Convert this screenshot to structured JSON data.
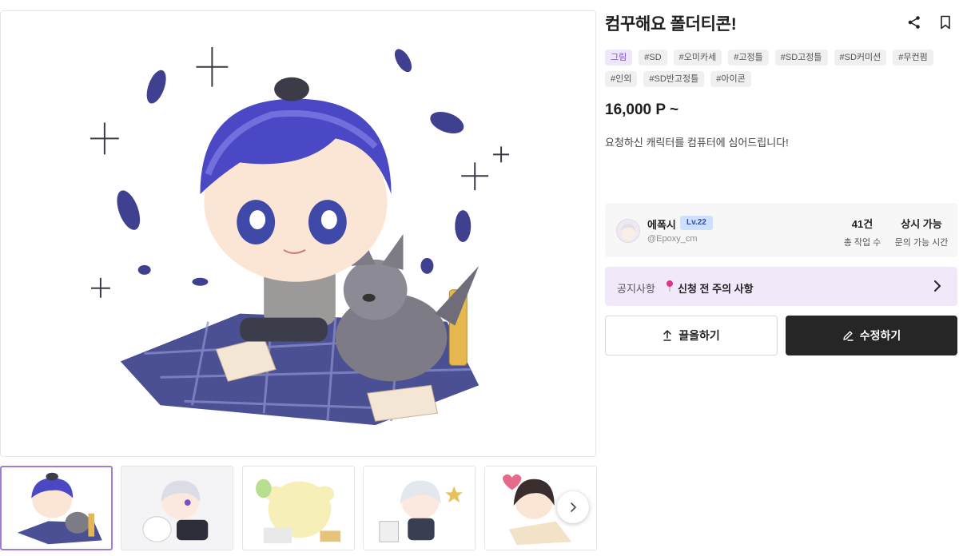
{
  "product": {
    "title": "컴꾸해요 폴더티콘!",
    "price": "16,000 P ~",
    "description": "요청하신 캐릭터를 컴퓨터에 심어드립니다!",
    "tags_row1": [
      "그림",
      "#SD",
      "#오미카세",
      "#고정틀",
      "#SD고정틀",
      "#SD커미션",
      "#무컨펌"
    ],
    "tags_row2": [
      "#인외",
      "#SD반고정틀",
      "#아이콘"
    ]
  },
  "seller": {
    "name": "에폭시",
    "level": "Lv.22",
    "handle": "@Epoxy_cm",
    "stat1_value": "41건",
    "stat1_label": "총 작업 수",
    "stat2_value": "상시 가능",
    "stat2_label": "문의 가능 시간"
  },
  "notice": {
    "label": "공지사항",
    "text": "신청 전 주의 사항"
  },
  "buttons": {
    "pull": "끌올하기",
    "edit": "수정하기"
  },
  "icons": {
    "share": "share-icon",
    "bookmark": "bookmark-icon",
    "pin": "pin-icon",
    "chevron": "chevron-right-icon",
    "upload": "upload-arrow-icon",
    "pencil": "pencil-icon"
  },
  "colors": {
    "accent": "#7b4fc9",
    "notice_bg": "#f1e9fa",
    "level_bg": "#cfe0ff",
    "edit_button": "#262626",
    "pin": "#e0338a"
  }
}
